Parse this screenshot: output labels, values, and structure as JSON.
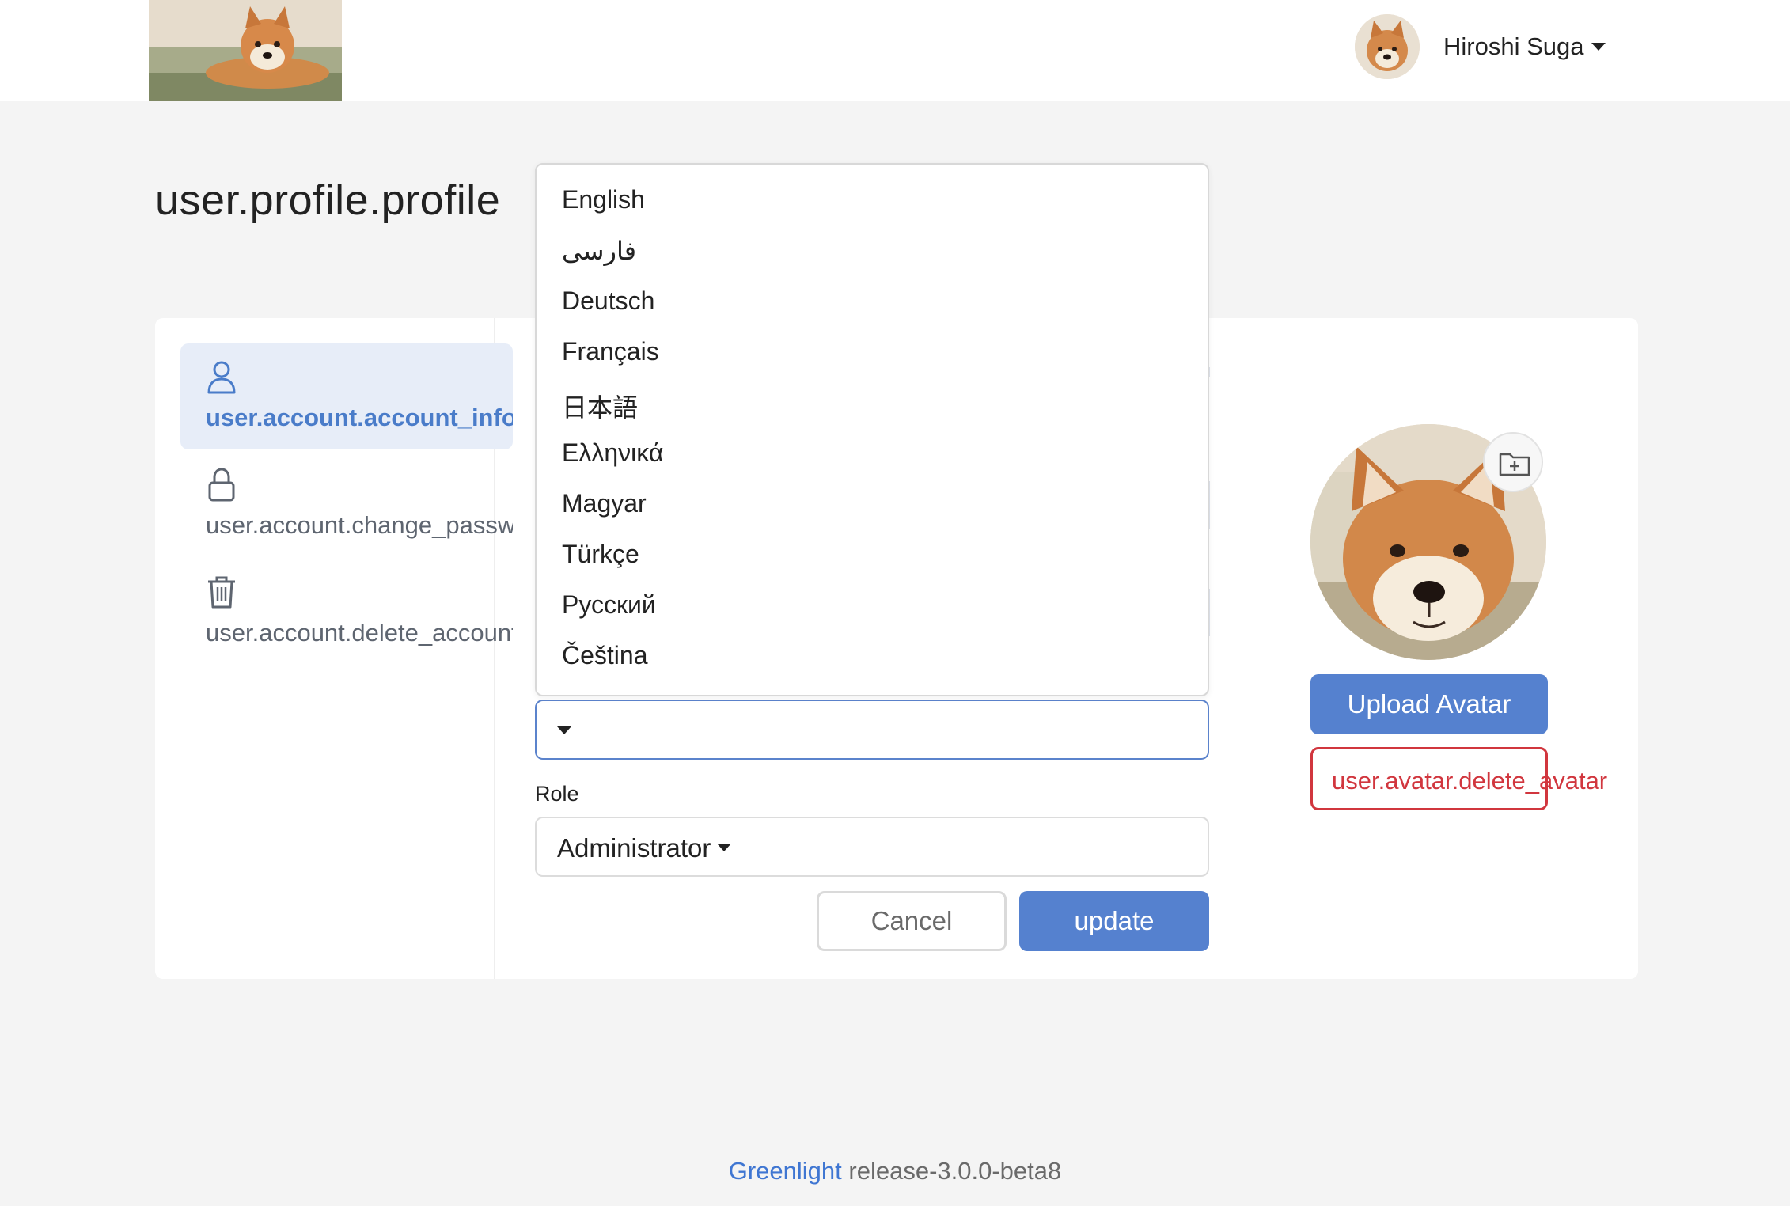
{
  "header": {
    "user_name": "Hiroshi Suga",
    "logo_icon": "shiba-logo-image",
    "avatar_icon": "shiba-avatar-image"
  },
  "page": {
    "title": "user.profile.profile"
  },
  "sidebar": {
    "items": [
      {
        "label": "user.account.account_info",
        "icon": "person-icon",
        "active": true
      },
      {
        "label": "user.account.change_password",
        "icon": "lock-icon",
        "active": false
      },
      {
        "label": "user.account.delete_account",
        "icon": "trash-icon",
        "active": false
      }
    ]
  },
  "language_dropdown": {
    "options": [
      "English",
      "فارسی",
      "Deutsch",
      "Français",
      "日本語",
      "Ελληνικά",
      "Magyar",
      "Türkçe",
      "Русский",
      "Čeština"
    ],
    "selected": ""
  },
  "form": {
    "role_label": "Role",
    "role_value": "Administrator",
    "cancel_label": "Cancel",
    "update_label": "update"
  },
  "avatar_panel": {
    "upload_label": "Upload Avatar",
    "delete_label": "user.avatar.delete_avatar",
    "folder_icon": "folder-plus-icon"
  },
  "footer": {
    "brand": "Greenlight",
    "version": "release-3.0.0-beta8"
  },
  "colors": {
    "accent": "#5581cf",
    "danger": "#d1363e",
    "active_bg": "#e7edf8",
    "page_bg": "#f4f4f4"
  }
}
